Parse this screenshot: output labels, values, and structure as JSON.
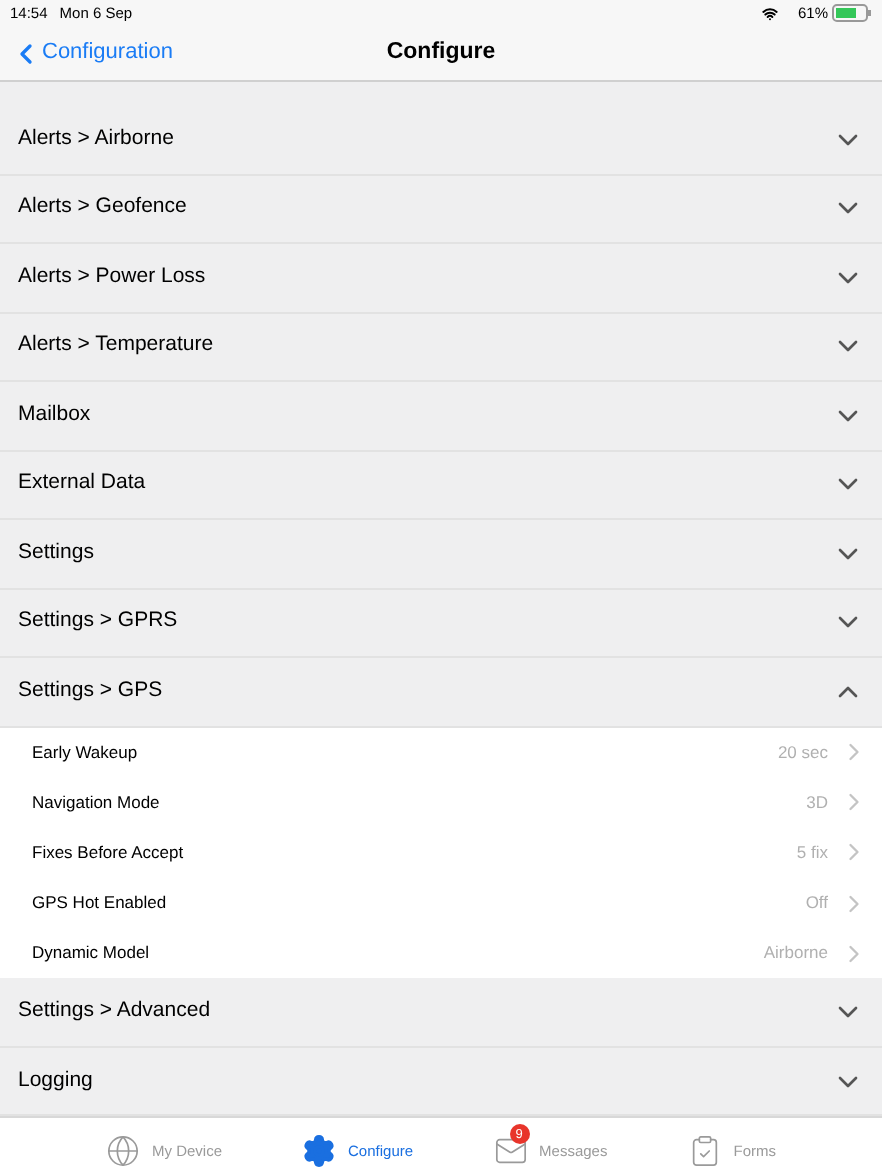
{
  "status_bar": {
    "time": "14:54",
    "date": "Mon 6 Sep",
    "battery": "61%"
  },
  "nav": {
    "back": "Configuration",
    "title": "Configure"
  },
  "sections": [
    {
      "title": "Alerts > Airborne",
      "expanded": false
    },
    {
      "title": "Alerts > Geofence",
      "expanded": false
    },
    {
      "title": "Alerts > Power Loss",
      "expanded": false
    },
    {
      "title": "Alerts > Temperature",
      "expanded": false
    },
    {
      "title": "Mailbox",
      "expanded": false
    },
    {
      "title": "External Data",
      "expanded": false
    },
    {
      "title": "Settings",
      "expanded": false
    },
    {
      "title": "Settings > GPRS",
      "expanded": false
    },
    {
      "title": "Settings > GPS",
      "expanded": true,
      "items": [
        {
          "label": "Early Wakeup",
          "value": "20 sec"
        },
        {
          "label": "Navigation Mode",
          "value": "3D"
        },
        {
          "label": "Fixes Before Accept",
          "value": "5 fix"
        },
        {
          "label": "GPS Hot Enabled",
          "value": "Off"
        },
        {
          "label": "Dynamic Model",
          "value": "Airborne"
        }
      ]
    },
    {
      "title": "Settings > Advanced",
      "expanded": false
    },
    {
      "title": "Logging",
      "expanded": false
    }
  ],
  "tabs": [
    {
      "label": "My Device",
      "kind": "globe",
      "selected": false
    },
    {
      "label": "Configure",
      "kind": "gears",
      "selected": true
    },
    {
      "label": "Messages",
      "kind": "mail",
      "selected": false,
      "badge": "9"
    },
    {
      "label": "Forms",
      "kind": "clipboard",
      "selected": false
    }
  ]
}
